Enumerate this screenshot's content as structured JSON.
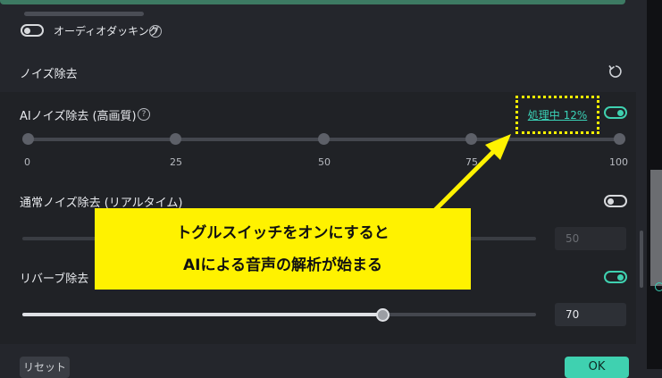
{
  "audio_ducking": {
    "label": "オーディオダッキング",
    "enabled": false
  },
  "noise_removal": {
    "section_title": "ノイズ除去",
    "reset_icon": "refresh-icon",
    "ai_noise": {
      "label": "AIノイズ除去 (高画質)",
      "status_text": "処理中 12%",
      "enabled": true,
      "ticks": [
        "0",
        "25",
        "50",
        "75",
        "100"
      ]
    },
    "normal_noise": {
      "label": "通常ノイズ除去 (リアルタイム)",
      "enabled": false,
      "value": "50"
    },
    "reverb": {
      "label": "リバーブ除去",
      "enabled": true,
      "value": "70",
      "level_percent": 70
    }
  },
  "annotation": {
    "line1": "トグルスイッチをオンにすると",
    "line2": "AIによる音声の解析が始まる",
    "color": "#fff200"
  },
  "footer": {
    "reset_label": "リセット",
    "ok_label": "OK"
  },
  "colors": {
    "accent": "#3fd1b0",
    "background": "#24262c"
  }
}
